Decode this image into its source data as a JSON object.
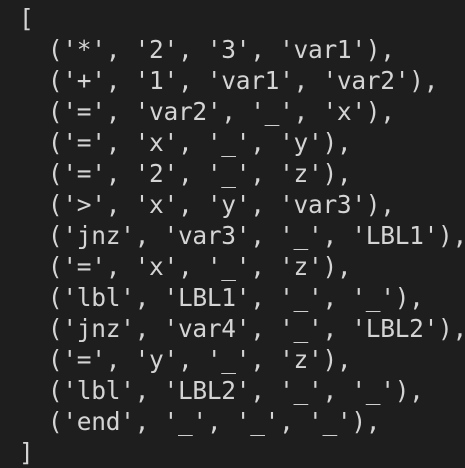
{
  "code": {
    "lines": [
      "[",
      "  ('*', '2', '3', 'var1'),",
      "  ('+', '1', 'var1', 'var2'),",
      "  ('=', 'var2', '_', 'x'),",
      "  ('=', 'x', '_', 'y'),",
      "  ('=', '2', '_', 'z'),",
      "  ('>', 'x', 'y', 'var3'),",
      "  ('jnz', 'var3', '_', 'LBL1'),",
      "  ('=', 'x', '_', 'z'),",
      "  ('lbl', 'LBL1', '_', '_'),",
      "  ('jnz', 'var4', '_', 'LBL2'),",
      "  ('=', 'y', '_', 'z'),",
      "  ('lbl', 'LBL2', '_', '_'),",
      "  ('end', '_', '_', '_'),",
      "]"
    ]
  },
  "colors": {
    "background": "#1e1e1e",
    "text": "#d4d4d4"
  }
}
